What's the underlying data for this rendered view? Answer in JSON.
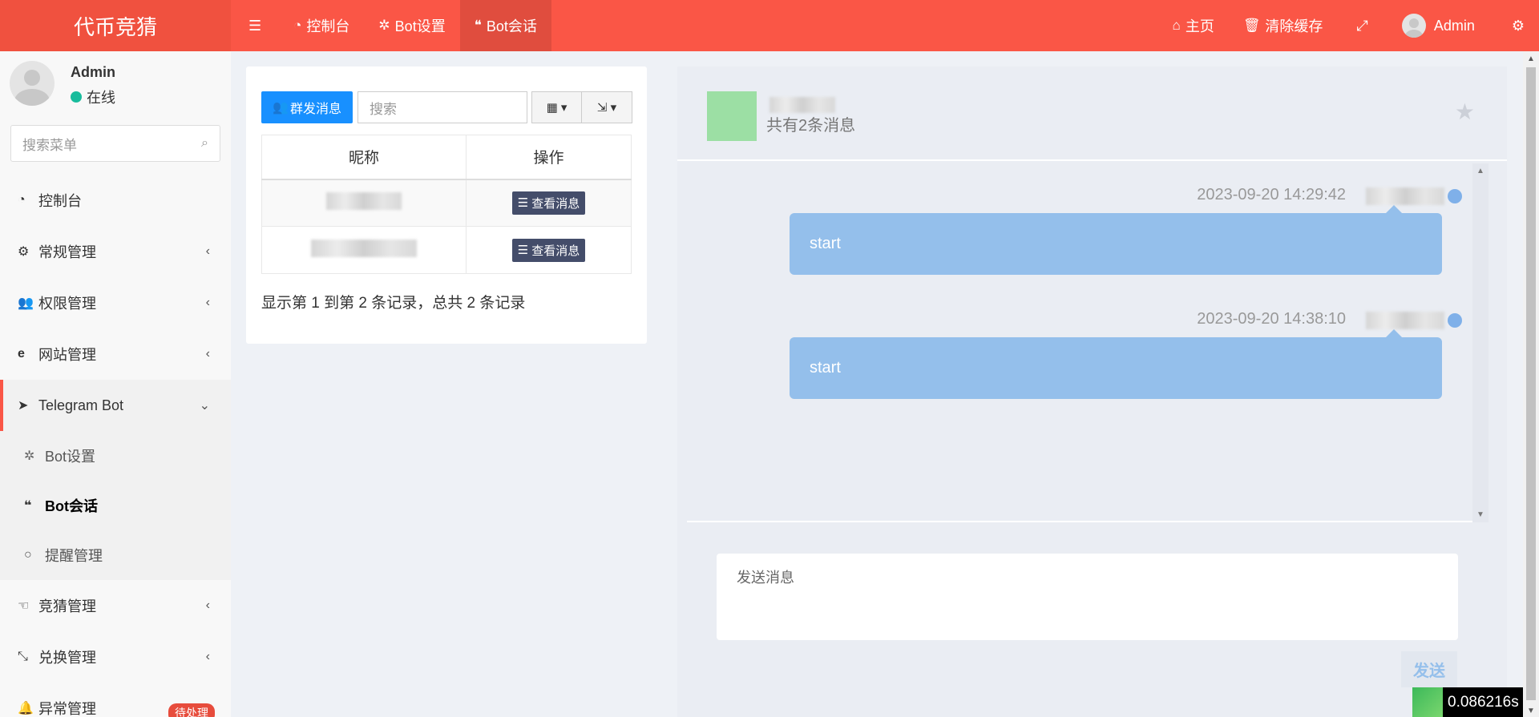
{
  "header": {
    "logo": "代币竞猜",
    "tabs": [
      {
        "icon": "dashboard-icon",
        "label": "控制台"
      },
      {
        "icon": "gear-icon",
        "label": "Bot设置"
      },
      {
        "icon": "comments-icon",
        "label": "Bot会话"
      }
    ],
    "right": {
      "home_label": "主页",
      "clear_cache_label": "清除缓存",
      "user_name": "Admin"
    },
    "accent": "#fa5646"
  },
  "sidebar": {
    "user": {
      "name": "Admin",
      "status": "在线"
    },
    "search_placeholder": "搜索菜单",
    "items": [
      {
        "label": "控制台"
      },
      {
        "label": "常规管理"
      },
      {
        "label": "权限管理"
      },
      {
        "label": "网站管理"
      },
      {
        "label": "Telegram Bot"
      },
      {
        "label": "Bot设置"
      },
      {
        "label": "Bot会话"
      },
      {
        "label": "提醒管理"
      },
      {
        "label": "竞猜管理"
      },
      {
        "label": "兑换管理"
      },
      {
        "label": "异常管理",
        "badge": "待处理"
      }
    ]
  },
  "list_panel": {
    "broadcast_button": "群发消息",
    "search_placeholder": "搜索",
    "columns": [
      "昵称",
      "操作"
    ],
    "rows": [
      {
        "action": "查看消息"
      },
      {
        "action": "查看消息"
      }
    ],
    "page_info": "显示第 1 到第 2 条记录，总共 2 条记录"
  },
  "chat": {
    "message_count": "共有2条消息",
    "messages": [
      {
        "time": "2023-09-20 14:29:42",
        "text": "start"
      },
      {
        "time": "2023-09-20 14:38:10",
        "text": "start"
      }
    ],
    "input_placeholder": "发送消息",
    "send_button": "发送",
    "bubble_color": "#94bfeb"
  },
  "timer": "0.086216s"
}
